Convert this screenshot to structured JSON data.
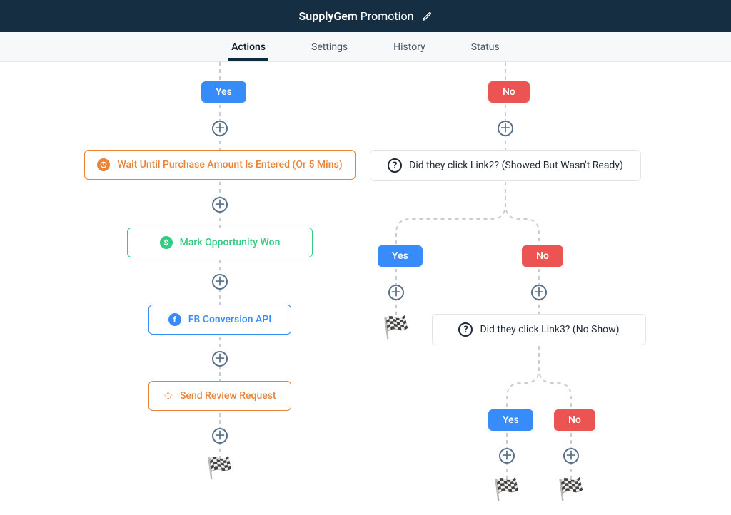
{
  "header": {
    "title_bold": "SupplyGem",
    "title_rest": " Promotion"
  },
  "tabs": {
    "actions": "Actions",
    "settings": "Settings",
    "history": "History",
    "status": "Status"
  },
  "badges": {
    "yes": "Yes",
    "no": "No"
  },
  "steps": {
    "wait_purchase": "Wait Until Purchase Amount Is Entered (Or 5 Mins)",
    "mark_won": "Mark Opportunity Won",
    "fb_api": "FB Conversion API",
    "send_review": "Send Review Request",
    "q_link2": "Did they click Link2? (Showed But Wasn't Ready)",
    "q_link3": "Did they click Link3? (No Show)"
  },
  "icons": {
    "question": "?",
    "dollar": "$",
    "facebook": "f"
  }
}
